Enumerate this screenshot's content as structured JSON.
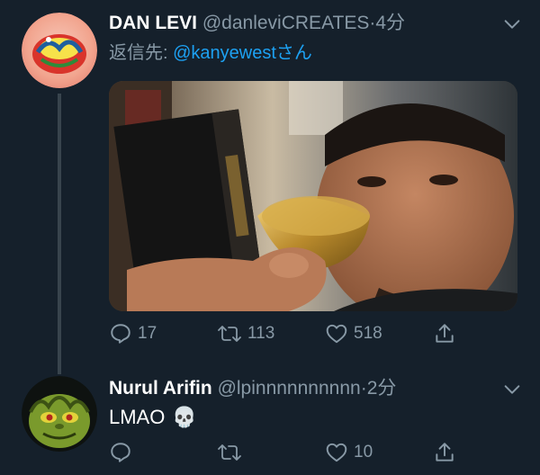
{
  "tweet1": {
    "display_name": "DAN LEVI",
    "handle": "@danleviCREATES",
    "separator": "·",
    "time": "4分",
    "reply_prefix": "返信先: ",
    "reply_mention": "@kanyewest",
    "reply_suffix": "さん",
    "media_description": "photo",
    "replies": "17",
    "retweets": "113",
    "likes": "518",
    "avatar_icon": "spit-logo-avatar"
  },
  "tweet2": {
    "display_name": "Nurul Arifin",
    "handle": "@lpinnnnnnnnnn",
    "separator": "·",
    "time": "2分",
    "text": "LMAO",
    "emoji": "💀",
    "replies": "",
    "retweets": "",
    "likes": "10",
    "avatar_icon": "grinch-avatar"
  },
  "colors": {
    "background": "#15202b",
    "muted": "#8899a6",
    "link": "#1da1f2",
    "thread_line": "#38444d"
  }
}
